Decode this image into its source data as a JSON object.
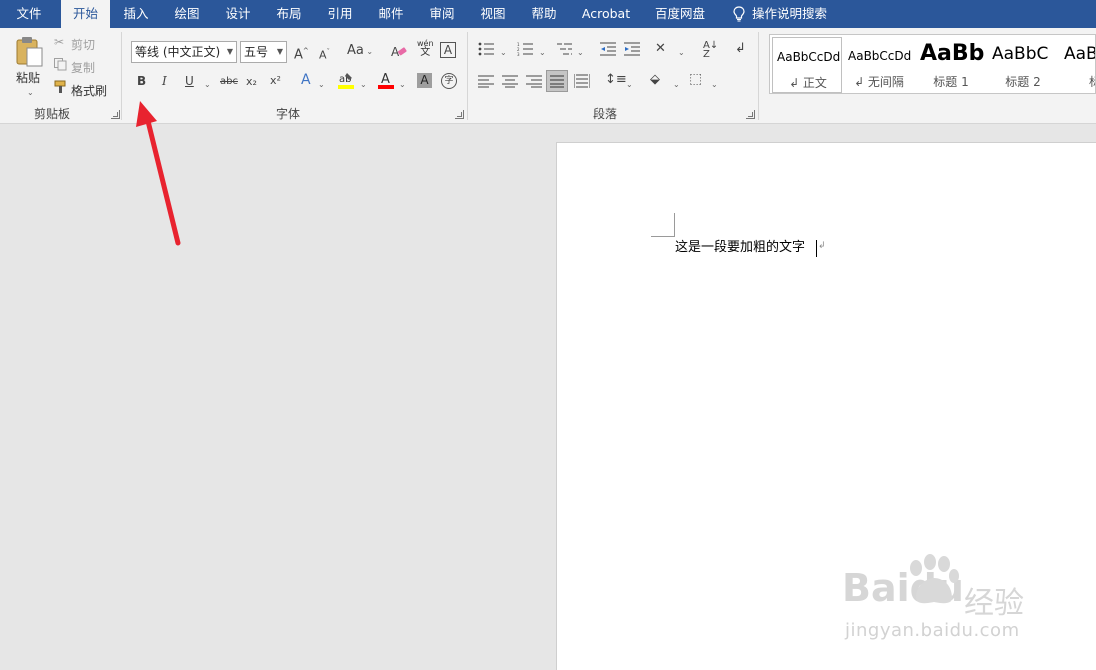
{
  "tabs": {
    "file": "文件",
    "home": "开始",
    "insert": "插入",
    "draw": "绘图",
    "design": "设计",
    "layout": "布局",
    "references": "引用",
    "mailings": "邮件",
    "review": "审阅",
    "view": "视图",
    "help": "帮助",
    "acrobat": "Acrobat",
    "baidu": "百度网盘",
    "tellme": "操作说明搜索"
  },
  "clipboard": {
    "label": "剪贴板",
    "paste": "粘贴",
    "cut": "剪切",
    "copy": "复制",
    "format_painter": "格式刷"
  },
  "font": {
    "label": "字体",
    "font_name": "等线 (中文正文)",
    "font_size": "五号",
    "bold": "B",
    "italic": "I",
    "underline": "U",
    "strikethrough": "abc",
    "subscript": "x₂",
    "superscript": "x²",
    "change_case": "Aa",
    "grow": "A",
    "shrink": "A",
    "phonetic_top": "wén",
    "phonetic_bottom": "文",
    "char_border": "A",
    "font_color": "A",
    "char_shading": "A",
    "enclose": "字",
    "highlight_color": "#ffff00",
    "font_color_value": "#ff0000"
  },
  "paragraph": {
    "label": "段落"
  },
  "styles": {
    "items": [
      {
        "sample": "AaBbCcDd",
        "name": "↲ 正文"
      },
      {
        "sample": "AaBbCcDd",
        "name": "↲ 无间隔"
      },
      {
        "sample": "AaBb",
        "name": "标题 1"
      },
      {
        "sample": "AaBbC",
        "name": "标题 2"
      },
      {
        "sample": "AaB",
        "name": "标"
      }
    ]
  },
  "document": {
    "text": "这是一段要加粗的文字",
    "para_mark": "↲"
  },
  "watermark": {
    "logo": "Baidu",
    "jingyan": "经验",
    "url": "jingyan.baidu.com"
  },
  "colors": {
    "accent": "#2b579a",
    "arrow": "#e8232f"
  }
}
